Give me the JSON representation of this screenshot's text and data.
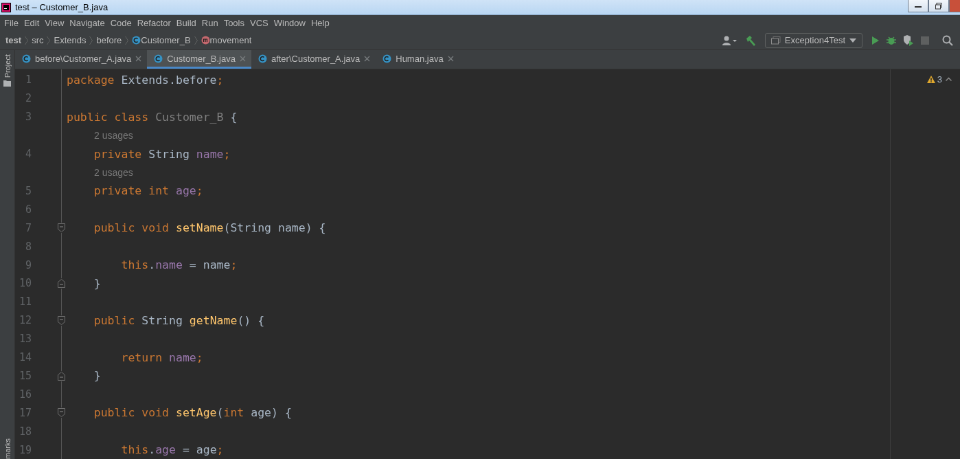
{
  "window": {
    "title": "test – Customer_B.java"
  },
  "menu": [
    "File",
    "Edit",
    "View",
    "Navigate",
    "Code",
    "Refactor",
    "Build",
    "Run",
    "Tools",
    "VCS",
    "Window",
    "Help"
  ],
  "breadcrumbs": [
    {
      "label": "test",
      "kind": "project"
    },
    {
      "label": "src",
      "kind": "folder"
    },
    {
      "label": "Extends",
      "kind": "folder"
    },
    {
      "label": "before",
      "kind": "folder"
    },
    {
      "label": "Customer_B",
      "kind": "class"
    },
    {
      "label": "movement",
      "kind": "method"
    }
  ],
  "run_config": {
    "label": "Exception4Test"
  },
  "side_panel": {
    "top": "Project",
    "bottom": "marks"
  },
  "tabs": [
    {
      "label": "before\\Customer_A.java",
      "selected": false
    },
    {
      "label": "Customer_B.java",
      "selected": true
    },
    {
      "label": "after\\Customer_A.java",
      "selected": false
    },
    {
      "label": "Human.java",
      "selected": false
    }
  ],
  "inspections": {
    "warnings": "3"
  },
  "lines": [
    {
      "kind": "code",
      "number": "1",
      "tokens": [
        {
          "t": "package ",
          "kind": "keyword"
        },
        {
          "t": "Extends.before",
          "kind": "plain"
        },
        {
          "t": ";",
          "kind": "keyword"
        }
      ]
    },
    {
      "kind": "code",
      "number": "2"
    },
    {
      "kind": "code",
      "number": "3",
      "tokens": [
        {
          "t": "public class ",
          "kind": "keyword"
        },
        {
          "t": "Customer_B",
          "kind": "unused"
        },
        {
          "t": " {",
          "kind": "plain"
        }
      ]
    },
    {
      "kind": "hint",
      "text": "2 usages"
    },
    {
      "kind": "code",
      "number": "4",
      "tokens": [
        {
          "t": "    private ",
          "kind": "keyword"
        },
        {
          "t": "String ",
          "kind": "plain"
        },
        {
          "t": "name",
          "kind": "field"
        },
        {
          "t": ";",
          "kind": "keyword"
        }
      ]
    },
    {
      "kind": "hint",
      "text": "2 usages"
    },
    {
      "kind": "code",
      "number": "5",
      "tokens": [
        {
          "t": "    private int ",
          "kind": "keyword"
        },
        {
          "t": "age",
          "kind": "field"
        },
        {
          "t": ";",
          "kind": "keyword"
        }
      ]
    },
    {
      "kind": "code",
      "number": "6"
    },
    {
      "kind": "code",
      "number": "7",
      "fold": {
        "kind": "open"
      },
      "tokens": [
        {
          "t": "    public void ",
          "kind": "keyword"
        },
        {
          "t": "setName",
          "kind": "method"
        },
        {
          "t": "(String name) {",
          "kind": "plain"
        }
      ]
    },
    {
      "kind": "code",
      "number": "8"
    },
    {
      "kind": "code",
      "number": "9",
      "tokens": [
        {
          "t": "        this",
          "kind": "keyword"
        },
        {
          "t": ".",
          "kind": "plain"
        },
        {
          "t": "name",
          "kind": "field"
        },
        {
          "t": " = name",
          "kind": "plain"
        },
        {
          "t": ";",
          "kind": "keyword"
        }
      ]
    },
    {
      "kind": "code",
      "number": "10",
      "fold": {
        "kind": "close"
      },
      "tokens": [
        {
          "t": "    }",
          "kind": "plain"
        }
      ]
    },
    {
      "kind": "code",
      "number": "11"
    },
    {
      "kind": "code",
      "number": "12",
      "fold": {
        "kind": "open"
      },
      "tokens": [
        {
          "t": "    public ",
          "kind": "keyword"
        },
        {
          "t": "String ",
          "kind": "plain"
        },
        {
          "t": "getName",
          "kind": "method"
        },
        {
          "t": "() {",
          "kind": "plain"
        }
      ]
    },
    {
      "kind": "code",
      "number": "13"
    },
    {
      "kind": "code",
      "number": "14",
      "tokens": [
        {
          "t": "        return ",
          "kind": "keyword"
        },
        {
          "t": "name",
          "kind": "field"
        },
        {
          "t": ";",
          "kind": "keyword"
        }
      ]
    },
    {
      "kind": "code",
      "number": "15",
      "fold": {
        "kind": "close"
      },
      "tokens": [
        {
          "t": "    }",
          "kind": "plain"
        }
      ]
    },
    {
      "kind": "code",
      "number": "16"
    },
    {
      "kind": "code",
      "number": "17",
      "fold": {
        "kind": "open"
      },
      "tokens": [
        {
          "t": "    public void ",
          "kind": "keyword"
        },
        {
          "t": "setAge",
          "kind": "method"
        },
        {
          "t": "(",
          "kind": "plain"
        },
        {
          "t": "int ",
          "kind": "keyword"
        },
        {
          "t": "age) {",
          "kind": "plain"
        }
      ]
    },
    {
      "kind": "code",
      "number": "18"
    },
    {
      "kind": "code",
      "number": "19",
      "tokens": [
        {
          "t": "        this",
          "kind": "keyword"
        },
        {
          "t": ".",
          "kind": "plain"
        },
        {
          "t": "age",
          "kind": "field"
        },
        {
          "t": " = age",
          "kind": "plain"
        },
        {
          "t": ";",
          "kind": "keyword"
        }
      ]
    }
  ]
}
